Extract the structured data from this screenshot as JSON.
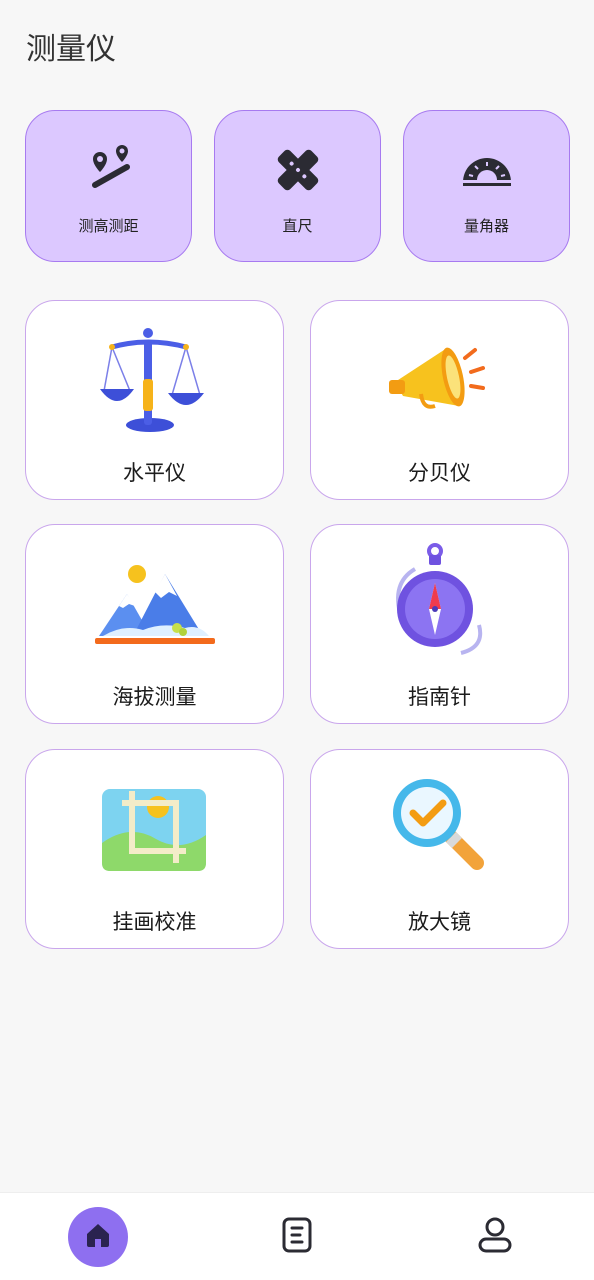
{
  "header": {
    "title": "测量仪"
  },
  "quick_tools": [
    {
      "label": "测高测距",
      "icon": "distance-pin-icon"
    },
    {
      "label": "直尺",
      "icon": "ruler-icon"
    },
    {
      "label": "量角器",
      "icon": "protractor-icon"
    }
  ],
  "tools": [
    {
      "label": "水平仪",
      "icon": "balance-scale-icon"
    },
    {
      "label": "分贝仪",
      "icon": "megaphone-icon"
    },
    {
      "label": "海拔测量",
      "icon": "mountain-icon"
    },
    {
      "label": "指南针",
      "icon": "compass-icon"
    },
    {
      "label": "挂画校准",
      "icon": "picture-frame-icon"
    },
    {
      "label": "放大镜",
      "icon": "magnifier-icon"
    }
  ],
  "bottom_nav": [
    {
      "name": "home",
      "icon": "home-icon",
      "active": true
    },
    {
      "name": "records",
      "icon": "document-icon",
      "active": false
    },
    {
      "name": "profile",
      "icon": "user-icon",
      "active": false
    }
  ],
  "colors": {
    "quick_card_bg": "#dcc8ff",
    "card_border": "#c9a6ec",
    "nav_active": "#8e6ff0",
    "page_bg": "#f7f7f7"
  }
}
